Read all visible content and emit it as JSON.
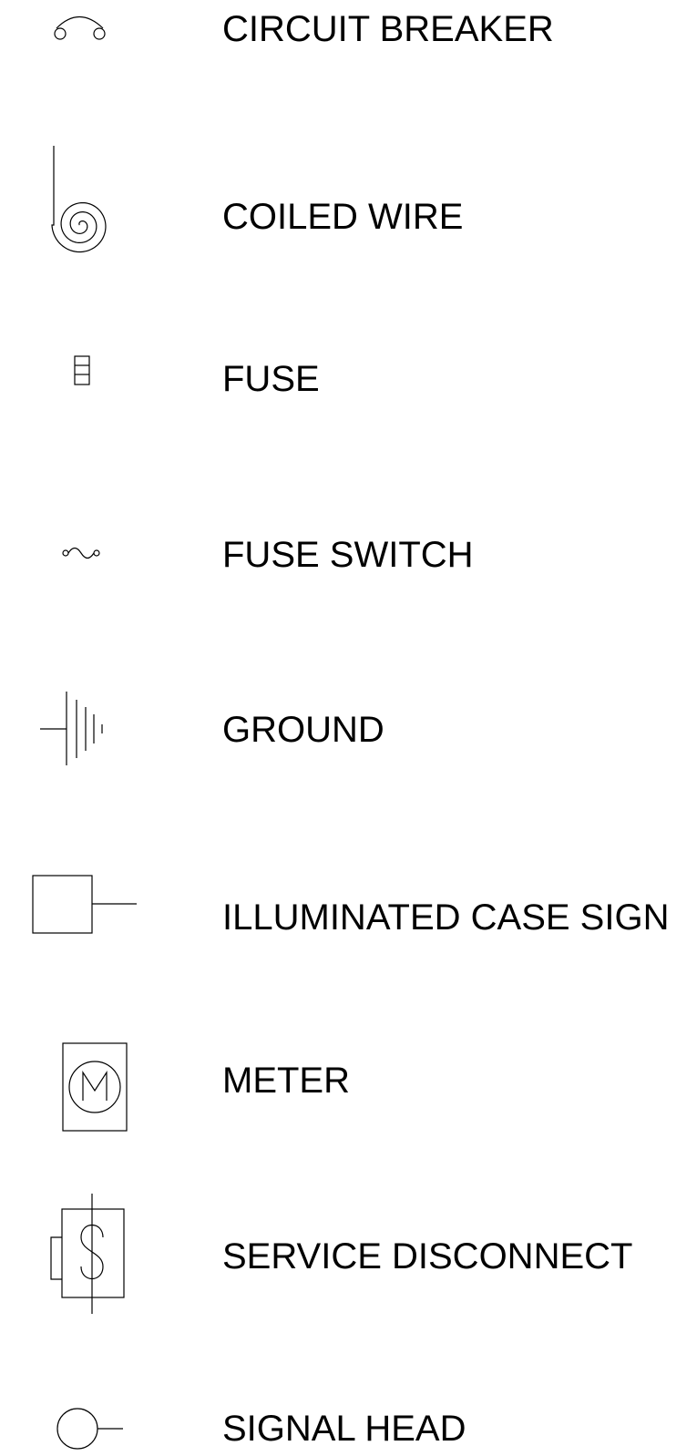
{
  "legend": {
    "items": [
      {
        "symbol": "circuit-breaker-icon",
        "label": "CIRCUIT BREAKER"
      },
      {
        "symbol": "coiled-wire-icon",
        "label": "COILED WIRE"
      },
      {
        "symbol": "fuse-icon",
        "label": "FUSE"
      },
      {
        "symbol": "fuse-switch-icon",
        "label": "FUSE SWITCH"
      },
      {
        "symbol": "ground-icon",
        "label": "GROUND"
      },
      {
        "symbol": "illuminated-case-sign-icon",
        "label": "ILLUMINATED CASE SIGN"
      },
      {
        "symbol": "meter-icon",
        "label": "METER"
      },
      {
        "symbol": "service-disconnect-icon",
        "label": "SERVICE DISCONNECT"
      },
      {
        "symbol": "signal-head-icon",
        "label": "SIGNAL HEAD"
      }
    ]
  }
}
